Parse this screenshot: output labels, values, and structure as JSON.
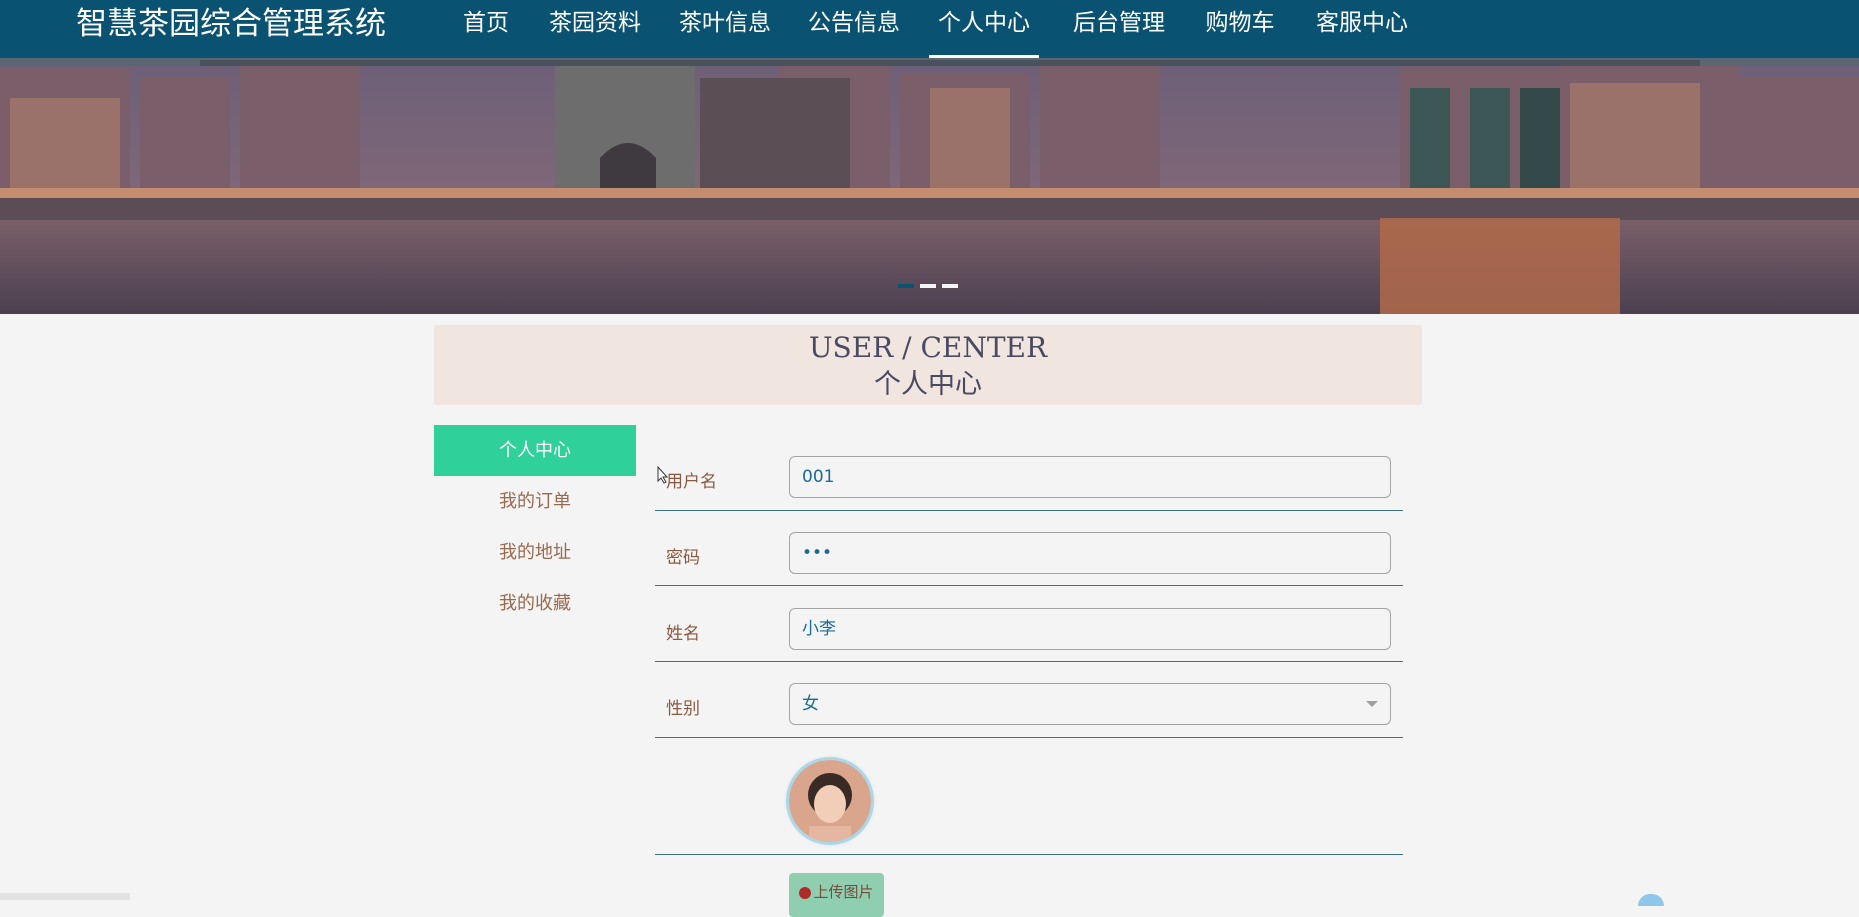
{
  "header": {
    "site_title": "智慧茶园综合管理系统",
    "bg_color": "#0a5272",
    "nav": [
      {
        "label": "首页",
        "active": false
      },
      {
        "label": "茶园资料",
        "active": false
      },
      {
        "label": "茶叶信息",
        "active": false
      },
      {
        "label": "公告信息",
        "active": false
      },
      {
        "label": "个人中心",
        "active": true
      },
      {
        "label": "后台管理",
        "active": false
      },
      {
        "label": "购物车",
        "active": false
      },
      {
        "label": "客服中心",
        "active": false
      }
    ]
  },
  "banner": {
    "image": "city-bridge-river-photo",
    "slides_count": 3,
    "active_slide": 1
  },
  "section": {
    "title_en": "USER / CENTER",
    "title_cn": "个人中心"
  },
  "side_menu": {
    "items": [
      {
        "label": "个人中心",
        "active": true
      },
      {
        "label": "我的订单",
        "active": false
      },
      {
        "label": "我的地址",
        "active": false
      },
      {
        "label": "我的收藏",
        "active": false
      }
    ],
    "active_color": "#2fd09a"
  },
  "form": {
    "username": {
      "label": "用户名",
      "value": "001"
    },
    "password": {
      "label": "密码",
      "value": "•••"
    },
    "name": {
      "label": "姓名",
      "value": "小李"
    },
    "gender": {
      "label": "性别",
      "value": "女"
    },
    "avatar": {
      "icon": "user-avatar-photo"
    },
    "upload_label": "上传图片"
  }
}
